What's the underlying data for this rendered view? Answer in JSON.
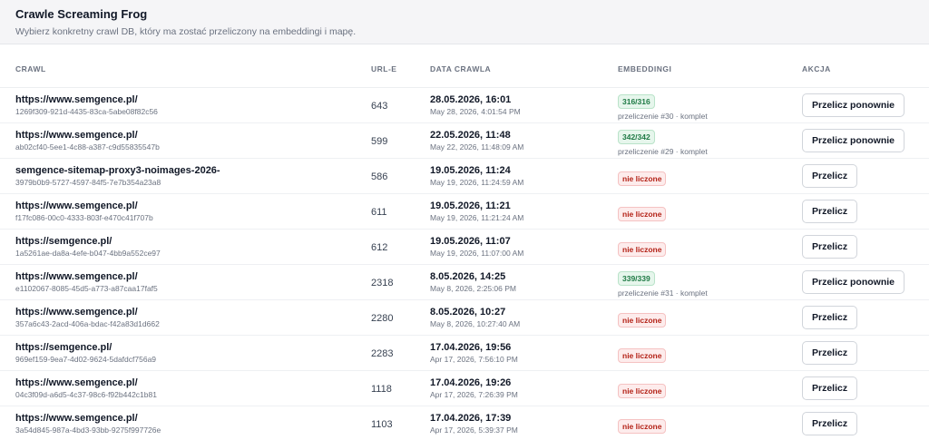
{
  "header": {
    "title": "Crawle Screaming Frog",
    "subtitle": "Wybierz konkretny crawl DB, który ma zostać przeliczony na embeddingi i mapę."
  },
  "columns": {
    "crawl": "CRAWL",
    "urle": "URL-E",
    "date": "DATA CRAWLA",
    "embeddings": "EMBEDDINGI",
    "action": "AKCJA"
  },
  "colors": {
    "badge_done": "#1f7a45",
    "badge_none": "#b42318"
  },
  "rows": [
    {
      "url": "https://www.semgence.pl/",
      "id": "1269f309-921d-4435-83ca-5abe08f82c56",
      "count": "643",
      "date": "28.05.2026, 16:01",
      "date_full": "May 28, 2026, 4:01:54 PM",
      "status": "done",
      "badge": "316/316",
      "note": "przeliczenie #30 · komplet",
      "action": "Przelicz ponownie"
    },
    {
      "url": "https://www.semgence.pl/",
      "id": "ab02cf40-5ee1-4c88-a387-c9d55835547b",
      "count": "599",
      "date": "22.05.2026, 11:48",
      "date_full": "May 22, 2026, 11:48:09 AM",
      "status": "done",
      "badge": "342/342",
      "note": "przeliczenie #29 · komplet",
      "action": "Przelicz ponownie"
    },
    {
      "url": "semgence-sitemap-proxy3-noimages-2026-",
      "id": "3979b0b9-5727-4597-84f5-7e7b354a23a8",
      "count": "586",
      "date": "19.05.2026, 11:24",
      "date_full": "May 19, 2026, 11:24:59 AM",
      "status": "none",
      "badge": "nie liczone",
      "note": "",
      "action": "Przelicz"
    },
    {
      "url": "https://www.semgence.pl/",
      "id": "f17fc086-00c0-4333-803f-e470c41f707b",
      "count": "611",
      "date": "19.05.2026, 11:21",
      "date_full": "May 19, 2026, 11:21:24 AM",
      "status": "none",
      "badge": "nie liczone",
      "note": "",
      "action": "Przelicz"
    },
    {
      "url": "https://semgence.pl/",
      "id": "1a5261ae-da8a-4efe-b047-4bb9a552ce97",
      "count": "612",
      "date": "19.05.2026, 11:07",
      "date_full": "May 19, 2026, 11:07:00 AM",
      "status": "none",
      "badge": "nie liczone",
      "note": "",
      "action": "Przelicz"
    },
    {
      "url": "https://www.semgence.pl/",
      "id": "e1102067-8085-45d5-a773-a87caa17faf5",
      "count": "2318",
      "date": "8.05.2026, 14:25",
      "date_full": "May 8, 2026, 2:25:06 PM",
      "status": "done",
      "badge": "339/339",
      "note": "przeliczenie #31 · komplet",
      "action": "Przelicz ponownie"
    },
    {
      "url": "https://www.semgence.pl/",
      "id": "357a6c43-2acd-406a-bdac-f42a83d1d662",
      "count": "2280",
      "date": "8.05.2026, 10:27",
      "date_full": "May 8, 2026, 10:27:40 AM",
      "status": "none",
      "badge": "nie liczone",
      "note": "",
      "action": "Przelicz"
    },
    {
      "url": "https://semgence.pl/",
      "id": "969ef159-9ea7-4d02-9624-5dafdcf756a9",
      "count": "2283",
      "date": "17.04.2026, 19:56",
      "date_full": "Apr 17, 2026, 7:56:10 PM",
      "status": "none",
      "badge": "nie liczone",
      "note": "",
      "action": "Przelicz"
    },
    {
      "url": "https://www.semgence.pl/",
      "id": "04c3f09d-a6d5-4c37-98c6-f92b442c1b81",
      "count": "1118",
      "date": "17.04.2026, 19:26",
      "date_full": "Apr 17, 2026, 7:26:39 PM",
      "status": "none",
      "badge": "nie liczone",
      "note": "",
      "action": "Przelicz"
    },
    {
      "url": "https://www.semgence.pl/",
      "id": "3a54d845-987a-4bd3-93bb-9275f997726e",
      "count": "1103",
      "date": "17.04.2026, 17:39",
      "date_full": "Apr 17, 2026, 5:39:37 PM",
      "status": "none",
      "badge": "nie liczone",
      "note": "",
      "action": "Przelicz"
    }
  ]
}
